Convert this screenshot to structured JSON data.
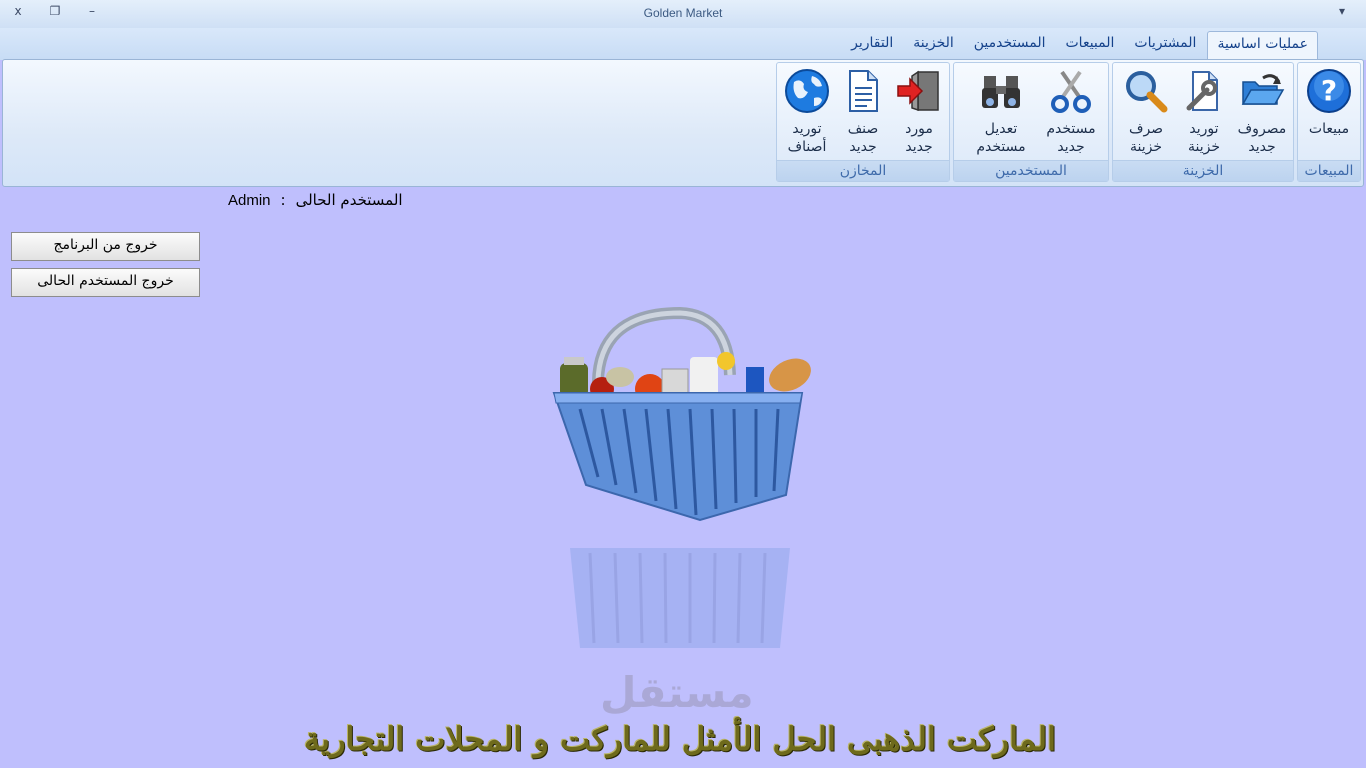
{
  "window": {
    "title": "Golden Market",
    "close_glyph": "x",
    "restore_glyph": "❐",
    "minimize_glyph": "–",
    "menu_glyph": "▾"
  },
  "tabs": [
    {
      "label": "عمليات اساسية",
      "active": true
    },
    {
      "label": "المشتريات"
    },
    {
      "label": "المبيعات"
    },
    {
      "label": "المستخدمين"
    },
    {
      "label": "الخزينة"
    },
    {
      "label": "التقارير"
    }
  ],
  "groups": {
    "sales": {
      "label": "المبيعات",
      "buttons": [
        {
          "label": "مبيعات",
          "icon": "help-icon"
        }
      ]
    },
    "treasury": {
      "label": "الخزينة",
      "buttons": [
        {
          "label": "مصروف\nجديد",
          "icon": "open-folder-icon"
        },
        {
          "label": "توريد\nخزينة",
          "icon": "document-tools-icon"
        },
        {
          "label": "صرف\nخزينة",
          "icon": "magnifier-icon"
        }
      ]
    },
    "users": {
      "label": "المستخدمين",
      "buttons": [
        {
          "label": "مستخدم\nجديد",
          "icon": "scissors-icon"
        },
        {
          "label": "تعديل\nمستخدم",
          "icon": "binoculars-icon"
        }
      ]
    },
    "stores": {
      "label": "المخازن",
      "buttons": [
        {
          "label": "مورد\nجديد",
          "icon": "enter-door-icon"
        },
        {
          "label": "صنف\nجديد",
          "icon": "document-icon"
        },
        {
          "label": "توريد\nأصناف",
          "icon": "globe-icon"
        }
      ]
    }
  },
  "main": {
    "current_user_label": "المستخدم الحالى",
    "separator": ":",
    "current_user_name": "Admin",
    "exit_program_label": "خروج من البرنامج",
    "logout_label": "خروج المستخدم الحالى",
    "watermark": "مستقل",
    "slogan": "الماركت الذهبى الحل الأمثل للماركت و المحلات التجارية"
  },
  "colors": {
    "background": "#bfbffd",
    "ribbon_text": "#15428b",
    "slogan": "#6e6a1c"
  }
}
